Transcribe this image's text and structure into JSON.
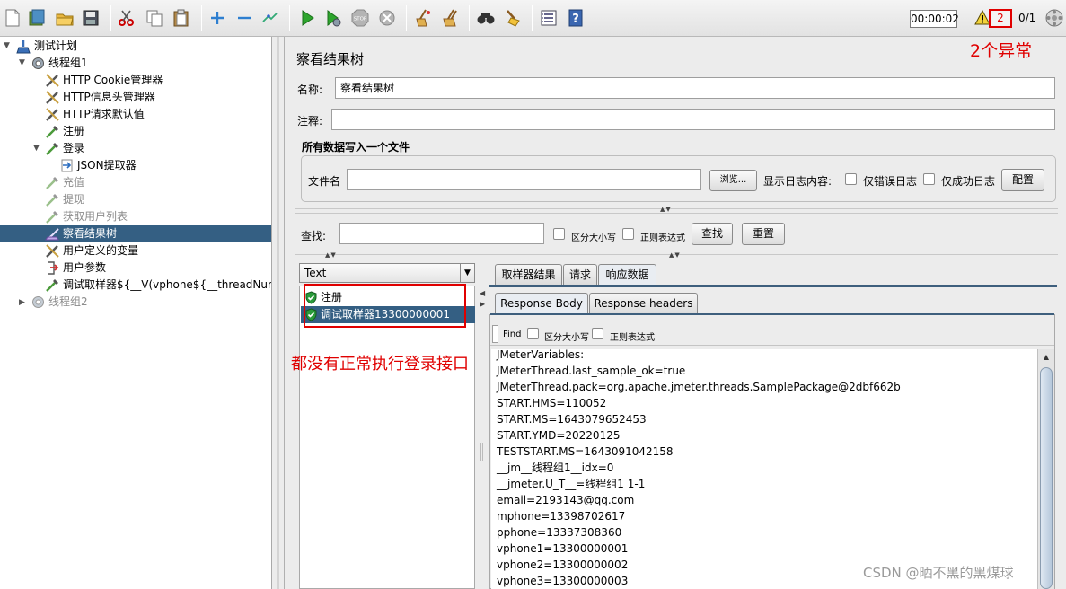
{
  "toolbar": {
    "timer": "00:00:02",
    "error_count": "2",
    "thread_count": "0/1",
    "exceptions_annotation": "2个异常"
  },
  "tree": {
    "items": [
      {
        "label": "测试计划",
        "icon": "test-plan-icon"
      },
      {
        "label": "线程组1",
        "icon": "gear-icon"
      },
      {
        "label": "HTTP Cookie管理器",
        "icon": "wrench-icon"
      },
      {
        "label": "HTTP信息头管理器",
        "icon": "wrench-icon"
      },
      {
        "label": "HTTP请求默认值",
        "icon": "wrench-icon"
      },
      {
        "label": "注册",
        "icon": "pipette-icon"
      },
      {
        "label": "登录",
        "icon": "pipette-icon"
      },
      {
        "label": "JSON提取器",
        "icon": "extractor-icon"
      },
      {
        "label": "充值",
        "icon": "pipette-icon"
      },
      {
        "label": "提现",
        "icon": "pipette-icon"
      },
      {
        "label": "获取用户列表",
        "icon": "pipette-icon"
      },
      {
        "label": "察看结果树",
        "icon": "listener-icon"
      },
      {
        "label": "用户定义的变量",
        "icon": "wrench-icon"
      },
      {
        "label": "用户参数",
        "icon": "user-params-icon"
      },
      {
        "label": "调试取样器${__V(vphone${__threadNum})}",
        "icon": "pipette-icon"
      },
      {
        "label": "线程组2",
        "icon": "gear-icon"
      }
    ]
  },
  "panel": {
    "title": "察看结果树",
    "name_label": "名称:",
    "name_value": "察看结果树",
    "comment_label": "注释:",
    "comment_value": "",
    "file_group_title": "所有数据写入一个文件",
    "filename_label": "文件名",
    "filename_value": "",
    "browse_label": "浏览...",
    "log_content_label": "显示日志内容:",
    "errors_only_label": "仅错误日志",
    "success_only_label": "仅成功日志",
    "configure_label": "配置",
    "search_label": "查找:",
    "search_value": "",
    "case_sensitive_label": "区分大小写",
    "regex_label": "正则表达式",
    "find_button": "查找",
    "reset_button": "重置"
  },
  "results": {
    "renderer": "Text",
    "samples": [
      "注册",
      "调试取样器13300000001"
    ],
    "login_annotation": "都没有正常执行登录接口",
    "tabs": [
      "取样器结果",
      "请求",
      "响应数据"
    ],
    "subtabs": [
      "Response Body",
      "Response headers"
    ],
    "find_label": "Find",
    "find_case_label": "区分大小写",
    "find_regex_label": "正则表达式",
    "response_lines": [
      "JMeterVariables:",
      "JMeterThread.last_sample_ok=true",
      "JMeterThread.pack=org.apache.jmeter.threads.SamplePackage@2dbf662b",
      "START.HMS=110052",
      "START.MS=1643079652453",
      "START.YMD=20220125",
      "TESTSTART.MS=1643091042158",
      "__jm__线程组1__idx=0",
      "__jmeter.U_T__=线程组1 1-1",
      "email=2193143@qq.com",
      "mphone=13398702617",
      "pphone=13337308360",
      "vphone1=13300000001",
      "vphone2=13300000002",
      "vphone3=13300000003"
    ]
  },
  "watermark": "CSDN @晒不黑的黑煤球"
}
